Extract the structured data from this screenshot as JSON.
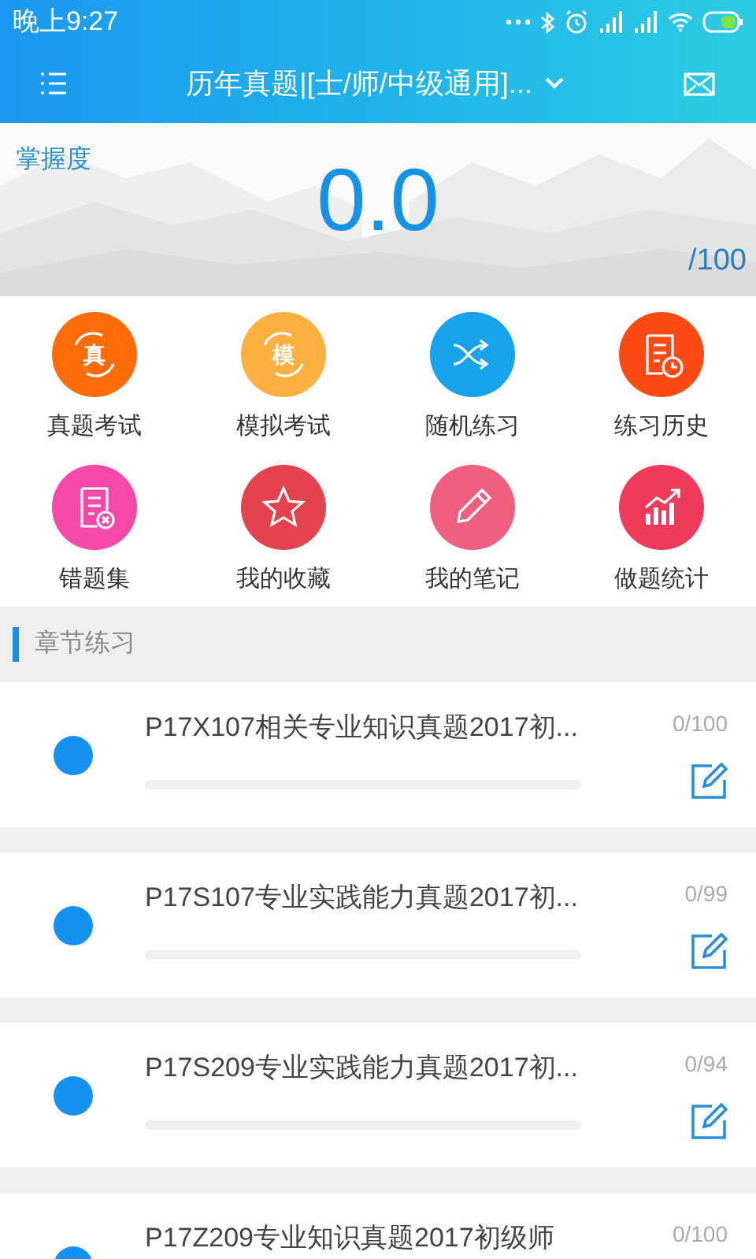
{
  "status_bar": {
    "time": "晚上9:27"
  },
  "header": {
    "title": "历年真题|[士/师/中级通用]..."
  },
  "mastery": {
    "label": "掌握度",
    "score": "0.0",
    "max": "/100"
  },
  "features": [
    {
      "label": "真题考试",
      "color": "#ff6d0a",
      "icon_text": "真"
    },
    {
      "label": "模拟考试",
      "color": "#fbb040",
      "icon_text": "模"
    },
    {
      "label": "随机练习",
      "color": "#16a3e9"
    },
    {
      "label": "练习历史",
      "color": "#fc4a14"
    },
    {
      "label": "错题集",
      "color": "#f548a8"
    },
    {
      "label": "我的收藏",
      "color": "#e4434d"
    },
    {
      "label": "我的笔记",
      "color": "#f0607e"
    },
    {
      "label": "做题统计",
      "color": "#f03a5c"
    }
  ],
  "section": {
    "title": "章节练习"
  },
  "chapters": [
    {
      "title": "P17X107相关专业知识真题2017初...",
      "count": "0/100",
      "level": 0
    },
    {
      "title": "P17S107专业实践能力真题2017初...",
      "count": "0/99",
      "level": 0
    },
    {
      "title": "P17S209专业实践能力真题2017初...",
      "count": "0/94",
      "level": 0
    },
    {
      "title": "P17Z209专业知识真题2017初级师",
      "count": "0/100"
    }
  ]
}
